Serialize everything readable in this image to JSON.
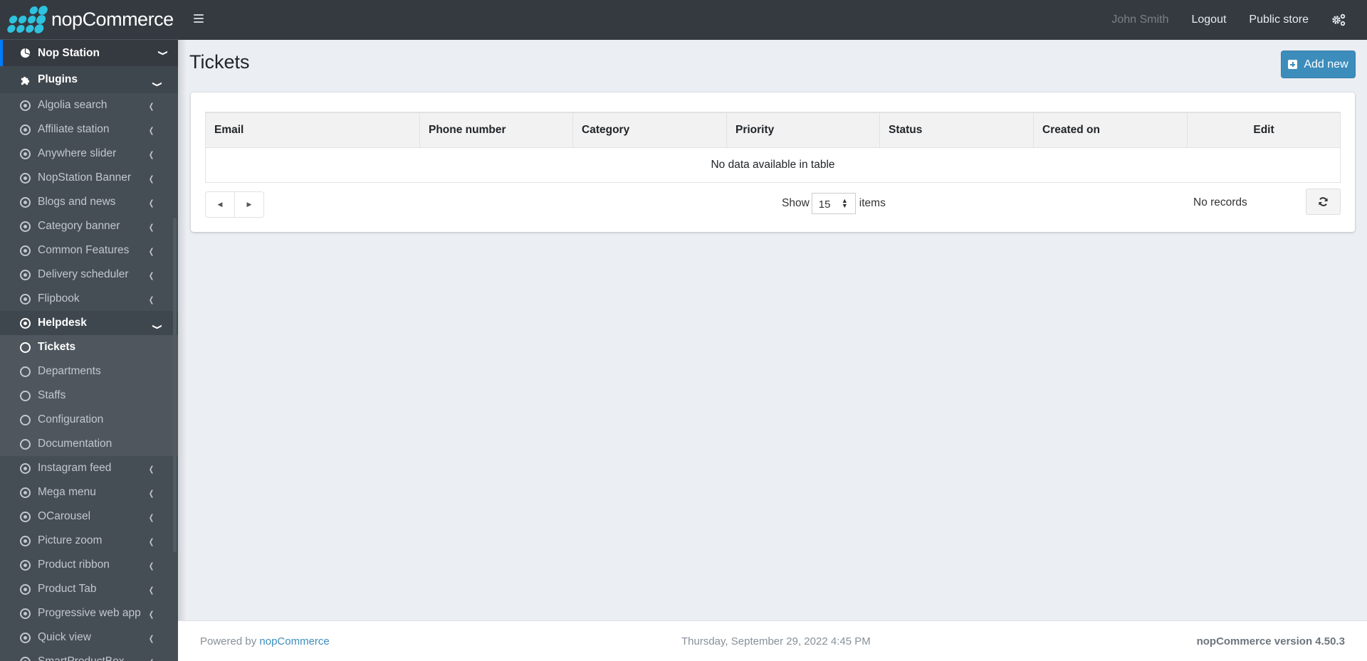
{
  "brand": {
    "name_light": "nop",
    "name_bold": "Commerce"
  },
  "topbar": {
    "user_name": "John Smith",
    "logout_label": "Logout",
    "public_store_label": "Public store",
    "settings_icon": "gears-icon",
    "menu_icon": "hamburger-icon"
  },
  "sidebar": {
    "root": {
      "label": "Nop Station",
      "icon": "chart-pie-icon"
    },
    "plugins": {
      "label": "Plugins",
      "icon": "puzzle-icon"
    },
    "items_before": [
      {
        "label": "Algolia search"
      },
      {
        "label": "Affiliate station"
      },
      {
        "label": "Anywhere slider"
      },
      {
        "label": "NopStation Banner"
      },
      {
        "label": "Blogs and news"
      },
      {
        "label": "Category banner"
      },
      {
        "label": "Common Features"
      },
      {
        "label": "Delivery scheduler"
      },
      {
        "label": "Flipbook"
      }
    ],
    "helpdesk": {
      "label": "Helpdesk",
      "children": [
        {
          "label": "Tickets",
          "active": true
        },
        {
          "label": "Departments"
        },
        {
          "label": "Staffs"
        },
        {
          "label": "Configuration"
        },
        {
          "label": "Documentation"
        }
      ]
    },
    "items_after": [
      {
        "label": "Instagram feed"
      },
      {
        "label": "Mega menu"
      },
      {
        "label": "OCarousel"
      },
      {
        "label": "Picture zoom"
      },
      {
        "label": "Product ribbon"
      },
      {
        "label": "Product Tab"
      },
      {
        "label": "Progressive web app"
      },
      {
        "label": "Quick view"
      },
      {
        "label": "SmartProductBox"
      }
    ]
  },
  "main": {
    "title": "Tickets",
    "add_new_label": "Add new",
    "table": {
      "columns": [
        "Email",
        "Phone number",
        "Category",
        "Priority",
        "Status",
        "Created on",
        "Edit"
      ],
      "empty_message": "No data available in table"
    },
    "pager": {
      "prev_icon": "caret-left-icon",
      "next_icon": "caret-right-icon",
      "show_label": "Show",
      "page_size": "15",
      "items_label": "items",
      "records_text": "No records"
    }
  },
  "footer": {
    "powered_by": "Powered by ",
    "powered_link": "nopCommerce",
    "datetime": "Thursday, September 29, 2022 4:45 PM",
    "version": "nopCommerce version 4.50.3"
  },
  "colors": {
    "accent": "#3c8dbc",
    "topbar": "#343a40",
    "sidebar": "#454d55",
    "active_border": "#007bff",
    "logo": "#2ec2de"
  }
}
